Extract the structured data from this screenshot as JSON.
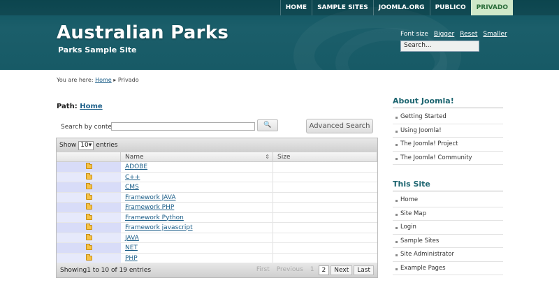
{
  "topnav": [
    "HOME",
    "SAMPLE SITES",
    "JOOMLA.ORG",
    "PUBLICO",
    "PRIVADO"
  ],
  "site": {
    "title": "Australian Parks",
    "subtitle": "Parks Sample Site"
  },
  "fontsize": {
    "label": "Font size",
    "bigger": "Bigger",
    "reset": "Reset",
    "smaller": "Smaller"
  },
  "search_top": {
    "value": "Search..."
  },
  "breadcrumb": {
    "prefix": "You are here:",
    "home": "Home",
    "sep": "▸",
    "current": "Privado"
  },
  "path": {
    "label": "Path:",
    "home": "Home"
  },
  "search": {
    "label": "Search by content:",
    "button_icon": "magnifier-icon",
    "button_glyph": "🔍",
    "advanced": "Advanced Search"
  },
  "table": {
    "show": "Show",
    "per_page": "10",
    "entries": "entries",
    "columns": [
      "",
      "Name",
      "Size"
    ],
    "rows": [
      "ADOBE",
      "C++",
      "CMS",
      "Framework JAVA",
      "Framework PHP",
      "Framework Python",
      "Framework javascript",
      "JAVA",
      "NET",
      "PHP"
    ],
    "info": "Showing1 to 10 of 19 entries",
    "pager": [
      "First",
      "Previous",
      "1",
      "2",
      "Next",
      "Last"
    ]
  },
  "sidebar": {
    "about_title": "About Joomla!",
    "about_items": [
      "Getting Started",
      "Using Joomla!",
      "The Joomla! Project",
      "The Joomla! Community"
    ],
    "site_title": "This Site",
    "site_items": [
      "Home",
      "Site Map",
      "Login",
      "Sample Sites",
      "Site Administrator",
      "Example Pages"
    ]
  },
  "colors": {
    "header": "#1b5e6a",
    "active_tab": "#cfe8c9",
    "link": "#1a5d88",
    "heading": "#1d6570"
  }
}
